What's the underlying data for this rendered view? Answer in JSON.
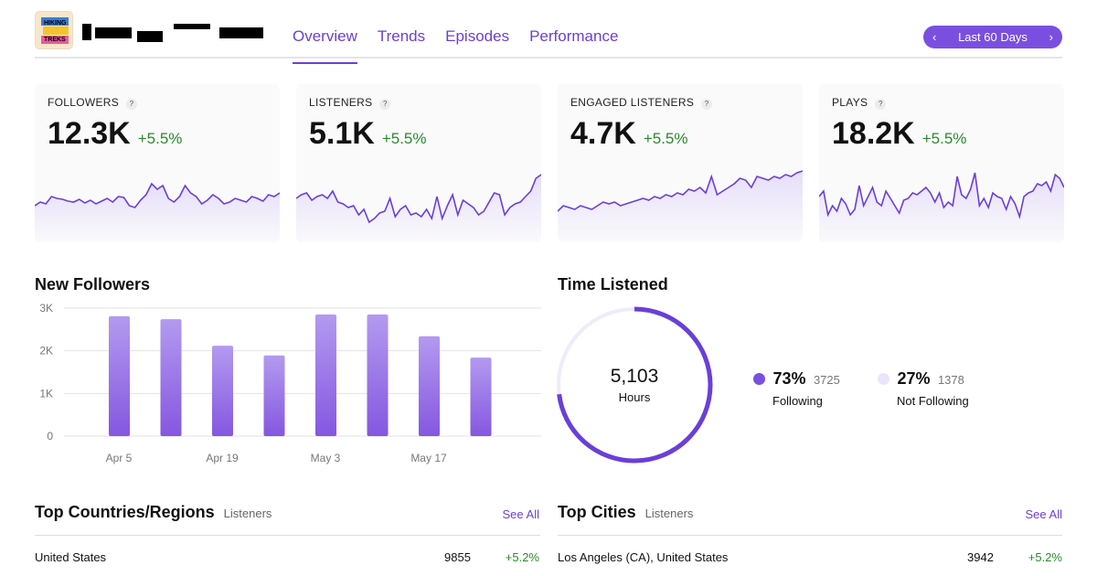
{
  "header": {
    "logo_text": "HIKING TREKS",
    "tabs": [
      "Overview",
      "Trends",
      "Episodes",
      "Performance"
    ],
    "active_tab": "Overview",
    "date_range": "Last 60 Days"
  },
  "colors": {
    "accent": "#6a3fd8",
    "positive": "#2a8a2a"
  },
  "metrics": [
    {
      "label": "FOLLOWERS",
      "value": "12.3K",
      "change": "+5.5%",
      "trend": [
        40,
        44,
        42,
        50,
        48,
        47,
        45,
        44,
        47,
        43,
        46,
        42,
        45,
        48,
        44,
        50,
        49,
        40,
        38,
        46,
        52,
        64,
        58,
        62,
        48,
        44,
        50,
        62,
        54,
        50,
        42,
        46,
        52,
        48,
        42,
        44,
        48,
        46,
        44,
        50,
        48,
        45,
        52,
        50,
        54
      ]
    },
    {
      "label": "LISTENERS",
      "value": "5.1K",
      "change": "+5.5%",
      "trend": [
        48,
        52,
        54,
        46,
        50,
        52,
        48,
        56,
        44,
        42,
        38,
        40,
        30,
        36,
        22,
        26,
        32,
        34,
        48,
        28,
        36,
        40,
        30,
        32,
        28,
        36,
        26,
        50,
        26,
        40,
        52,
        30,
        46,
        42,
        38,
        30,
        34,
        44,
        54,
        52,
        30,
        38,
        42,
        44,
        50,
        56,
        70,
        74
      ]
    },
    {
      "label": "ENGAGED LISTENERS",
      "value": "4.7K",
      "change": "+5.5%",
      "trend": [
        34,
        40,
        38,
        36,
        40,
        38,
        36,
        40,
        44,
        42,
        44,
        40,
        42,
        44,
        46,
        48,
        46,
        50,
        48,
        52,
        50,
        54,
        52,
        58,
        56,
        60,
        54,
        72,
        52,
        56,
        60,
        64,
        70,
        68,
        60,
        72,
        70,
        68,
        72,
        70,
        74,
        72,
        76,
        78
      ]
    },
    {
      "label": "PLAYS",
      "value": "18.2K",
      "change": "+5.5%",
      "trend": [
        50,
        56,
        30,
        40,
        34,
        48,
        42,
        30,
        36,
        62,
        40,
        50,
        60,
        44,
        40,
        56,
        48,
        40,
        32,
        46,
        48,
        54,
        52,
        56,
        60,
        54,
        44,
        54,
        38,
        44,
        40,
        72,
        52,
        48,
        58,
        76,
        40,
        48,
        38,
        54,
        50,
        48,
        36,
        50,
        42,
        28,
        50,
        54,
        56,
        64,
        62,
        66,
        56,
        74,
        70,
        60
      ]
    }
  ],
  "new_followers": {
    "title": "New Followers",
    "chart_data": {
      "type": "bar",
      "categories": [
        "Apr 5",
        "",
        "Apr 19",
        "",
        "May 3",
        "",
        "May 17",
        ""
      ],
      "x_tick_labels": [
        "Apr 5",
        "Apr 19",
        "May 3",
        "May 17"
      ],
      "values": [
        2810,
        2740,
        2120,
        1890,
        2850,
        2850,
        2340,
        1840
      ],
      "ylim": [
        0,
        3000
      ],
      "y_ticks": [
        "0",
        "1K",
        "2K",
        "3K"
      ],
      "grid": true
    }
  },
  "time_listened": {
    "title": "Time Listened",
    "total": "5,103",
    "unit": "Hours",
    "chart_data": {
      "type": "pie",
      "segments": [
        {
          "name": "Following",
          "percent": 73,
          "value": 3725,
          "label": "73%",
          "count": "3725"
        },
        {
          "name": "Not Following",
          "percent": 27,
          "value": 1378,
          "label": "27%",
          "count": "1378"
        }
      ]
    }
  },
  "top_countries": {
    "title": "Top Countries/Regions",
    "subtitle": "Listeners",
    "see_all": "See All",
    "rows": [
      {
        "name": "United States",
        "value": "9855",
        "change": "+5.2%"
      }
    ]
  },
  "top_cities": {
    "title": "Top Cities",
    "subtitle": "Listeners",
    "see_all": "See All",
    "rows": [
      {
        "name": "Los Angeles (CA), United States",
        "value": "3942",
        "change": "+5.2%"
      }
    ]
  }
}
